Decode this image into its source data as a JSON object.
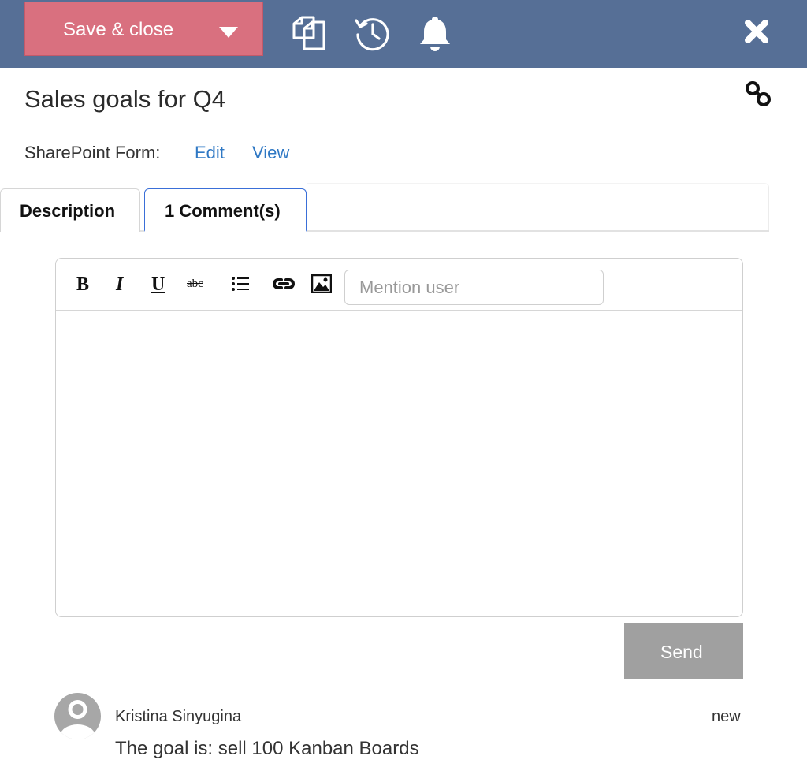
{
  "toolbar": {
    "save_label": "Save & close",
    "icons": [
      "copy-icon",
      "history-icon",
      "bell-icon",
      "close-icon"
    ]
  },
  "item": {
    "title": "Sales goals for Q4"
  },
  "sharepoint_form": {
    "label": "SharePoint Form:",
    "edit_label": "Edit",
    "view_label": "View"
  },
  "tabs": [
    {
      "label": "Description",
      "active": false
    },
    {
      "label": "1 Comment(s)",
      "active": true
    }
  ],
  "editor": {
    "tools": {
      "bold": "B",
      "italic": "I",
      "underline": "U",
      "strike": "abc"
    },
    "mention_placeholder": "Mention user",
    "send_label": "Send"
  },
  "comments": [
    {
      "author": "Kristina Sinyugina",
      "status": "new",
      "text": "The goal is: sell 100 Kanban Boards"
    }
  ],
  "colors": {
    "header": "#566f96",
    "save_button": "#d9707f",
    "link": "#2f78c4",
    "active_tab_border": "#3a6fd8",
    "send_button": "#a0a0a0"
  }
}
